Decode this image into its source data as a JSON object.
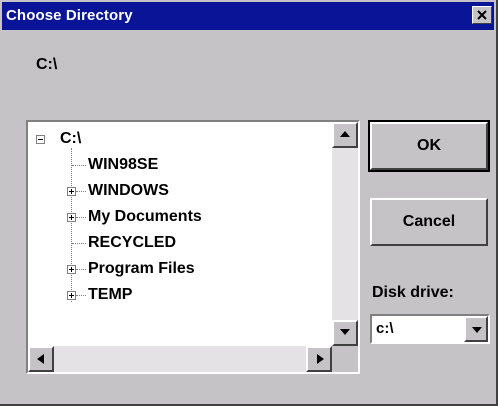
{
  "window": {
    "title": "Choose Directory"
  },
  "current_path": "C:\\",
  "tree": {
    "root": "C:\\",
    "items": [
      {
        "label": "WIN98SE",
        "expandable": false
      },
      {
        "label": "WINDOWS",
        "expandable": true
      },
      {
        "label": "My Documents",
        "expandable": true
      },
      {
        "label": "RECYCLED",
        "expandable": false
      },
      {
        "label": "Program Files",
        "expandable": true
      },
      {
        "label": "TEMP",
        "expandable": true
      }
    ]
  },
  "buttons": {
    "ok": "OK",
    "cancel": "Cancel"
  },
  "drive": {
    "label": "Disk drive:",
    "value": "c:\\"
  },
  "colors": {
    "title_bar": "#0a1496",
    "face": "#c6c3c6"
  }
}
